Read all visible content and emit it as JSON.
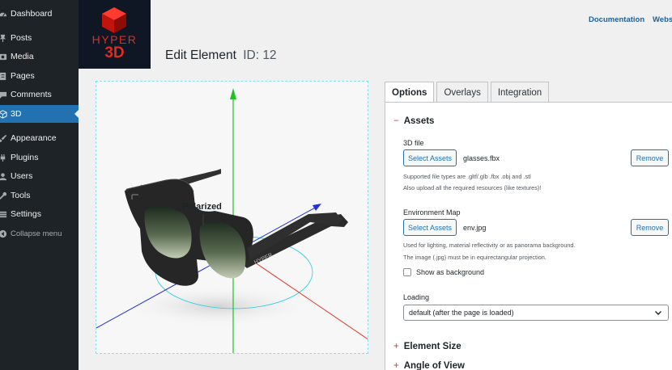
{
  "sidebar": {
    "items": [
      {
        "label": "Dashboard",
        "icon": "dashboard-icon"
      },
      {
        "label": "Posts",
        "icon": "pin-icon"
      },
      {
        "label": "Media",
        "icon": "media-icon"
      },
      {
        "label": "Pages",
        "icon": "page-icon"
      },
      {
        "label": "Comments",
        "icon": "comment-icon"
      },
      {
        "label": "3D",
        "icon": "cube-icon"
      },
      {
        "label": "Appearance",
        "icon": "brush-icon"
      },
      {
        "label": "Plugins",
        "icon": "plug-icon"
      },
      {
        "label": "Users",
        "icon": "user-icon"
      },
      {
        "label": "Tools",
        "icon": "wrench-icon"
      },
      {
        "label": "Settings",
        "icon": "settings-icon"
      }
    ],
    "collapse_label": "Collapse menu"
  },
  "logo": {
    "line1": "HYPER",
    "line2": "3D"
  },
  "toplinks": {
    "documentation": "Documentation",
    "website": "Websi"
  },
  "page": {
    "title": "Edit Element",
    "id_label": "ID: 12"
  },
  "viewer": {
    "annotation": "Polarized",
    "brand_on_temple": "HYPER"
  },
  "tabs": [
    {
      "label": "Options",
      "active": true
    },
    {
      "label": "Overlays",
      "active": false
    },
    {
      "label": "Integration",
      "active": false
    }
  ],
  "assets": {
    "heading": "Assets",
    "heading_sign": "−",
    "file3d": {
      "label": "3D file",
      "button": "Select Assets",
      "filename": "glasses.fbx",
      "remove": "Remove",
      "help1": "Supported file types are .gltf/.glb .fbx .obj and .stl",
      "help2": "Also upload all the required resources (like textures)!"
    },
    "envmap": {
      "label": "Environment Map",
      "button": "Select Assets",
      "filename": "env.jpg",
      "remove": "Remove",
      "help1": "Used for lighting, material reflectivity or as panorama background.",
      "help2": "The image (.jpg) must be in equirectangular projection."
    },
    "show_bg": {
      "label": "Show as background",
      "checked": false
    },
    "loading": {
      "label": "Loading",
      "value": "default (after the page is loaded)"
    }
  },
  "sections": {
    "element_size": {
      "label": "Element Size",
      "sign": "+"
    },
    "angle_of_view": {
      "label": "Angle of View",
      "sign": "+"
    }
  },
  "colors": {
    "accent": "#2271b1",
    "brand_red": "#e02b20",
    "sidebar_bg": "#1d2327"
  }
}
